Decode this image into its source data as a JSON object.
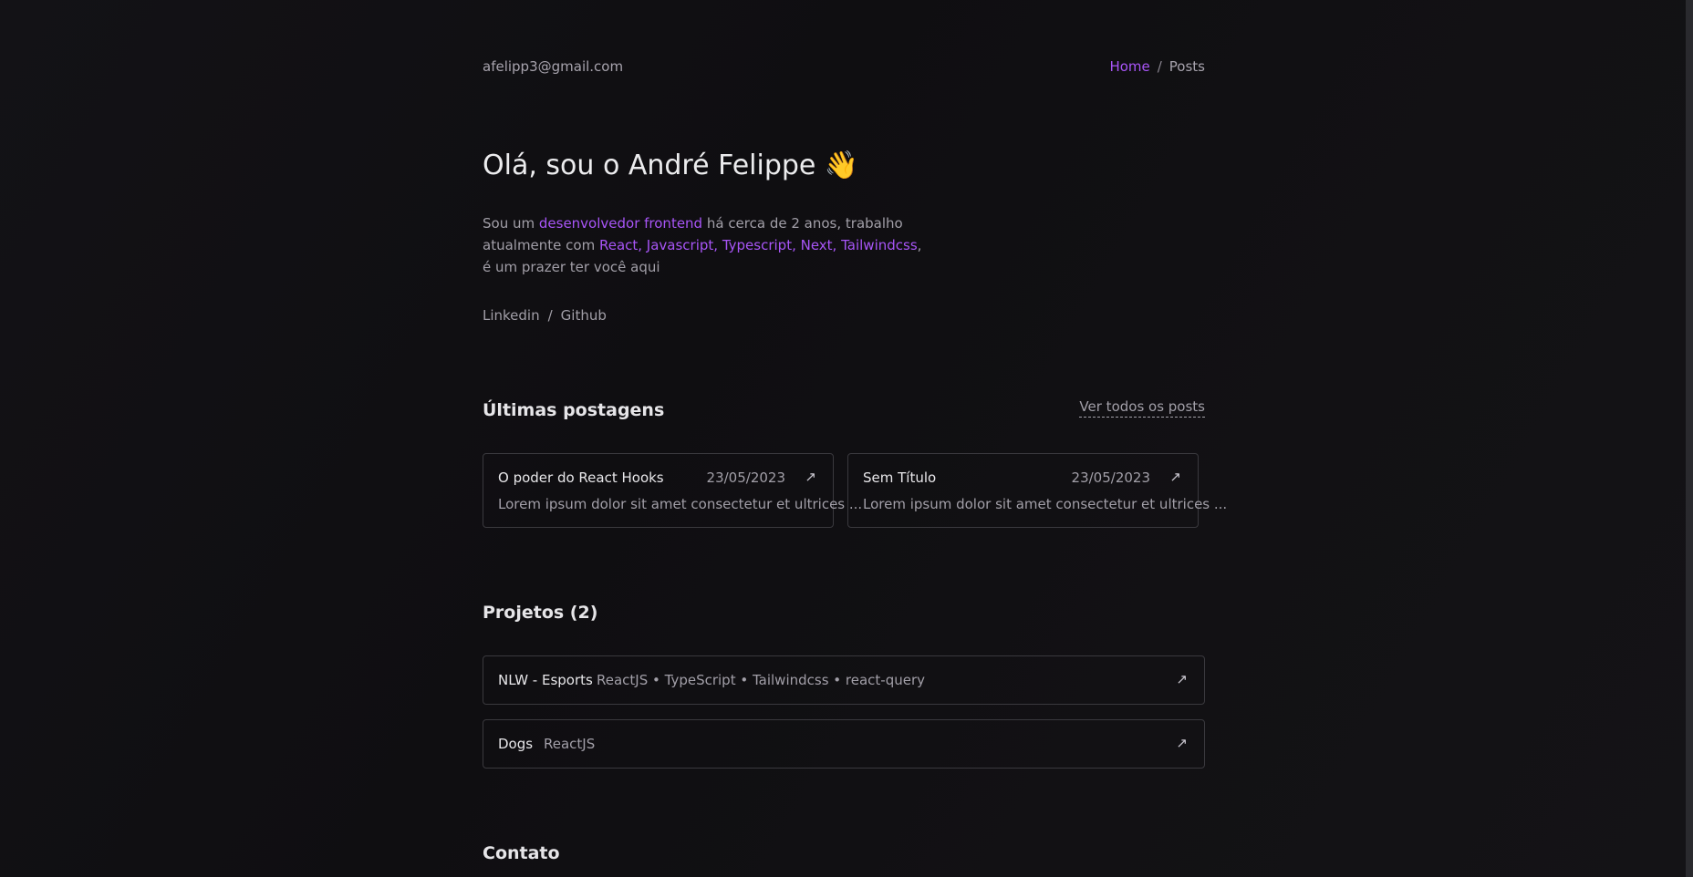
{
  "header": {
    "email": "afelipp3@gmail.com",
    "breadcrumb": {
      "home": "Home",
      "separator": "/",
      "current": "Posts"
    }
  },
  "hero": {
    "title": "Olá, sou o André Felippe 👋",
    "desc": {
      "p1": "Sou um ",
      "role": "desenvolvedor frontend",
      "p2": " há cerca de 2 anos, trabalho atualmente com ",
      "stack": "React, Javascript, Typescript, Next, Tailwindcss",
      "p3": ", é um prazer ter você aqui"
    },
    "social": {
      "linkedin": "Linkedin",
      "separator": "/",
      "github": "Github"
    }
  },
  "posts": {
    "title": "Últimas postagens",
    "see_all": "Ver todos os posts",
    "items": [
      {
        "title": "O poder do React Hooks",
        "date": "23/05/2023",
        "excerpt": "Lorem ipsum dolor sit amet consectetur et ultrices ..."
      },
      {
        "title": "Sem Título",
        "date": "23/05/2023",
        "excerpt": "Lorem ipsum dolor sit amet consectetur et ultrices ..."
      }
    ]
  },
  "projects": {
    "title": "Projetos (2)",
    "items": [
      {
        "name": "NLW - Esports",
        "tech": "ReactJS • TypeScript • Tailwindcss • react-query"
      },
      {
        "name": "Dogs",
        "tech": "ReactJS"
      }
    ]
  },
  "contact": {
    "title": "Contato"
  },
  "icons": {
    "arrow": "arrow-up-right-icon"
  },
  "colors": {
    "accent": "#a855f7",
    "background": "#111013"
  }
}
